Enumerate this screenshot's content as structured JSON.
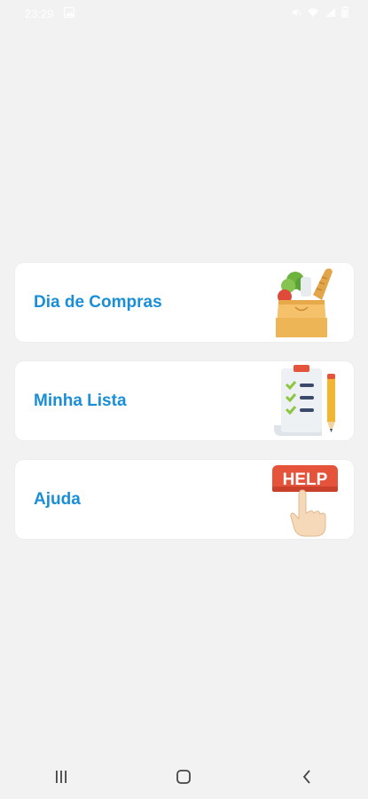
{
  "status_bar": {
    "time": "23:29",
    "icons": [
      "gallery-notification-icon",
      "mute-icon",
      "wifi-icon",
      "signal-icon",
      "battery-icon"
    ]
  },
  "menu": {
    "items": [
      {
        "label": "Dia de Compras",
        "icon": "grocery-bag-icon"
      },
      {
        "label": "Minha Lista",
        "icon": "checklist-icon"
      },
      {
        "label": "Ajuda",
        "icon": "help-hand-icon",
        "badge_text": "HELP"
      }
    ]
  },
  "nav_bar": {
    "buttons": [
      "recent-apps-icon",
      "home-icon",
      "back-icon"
    ]
  },
  "colors": {
    "background": "#f2f2f2",
    "card": "#ffffff",
    "label": "#1a8fd8",
    "help_badge": "#e5533b"
  }
}
